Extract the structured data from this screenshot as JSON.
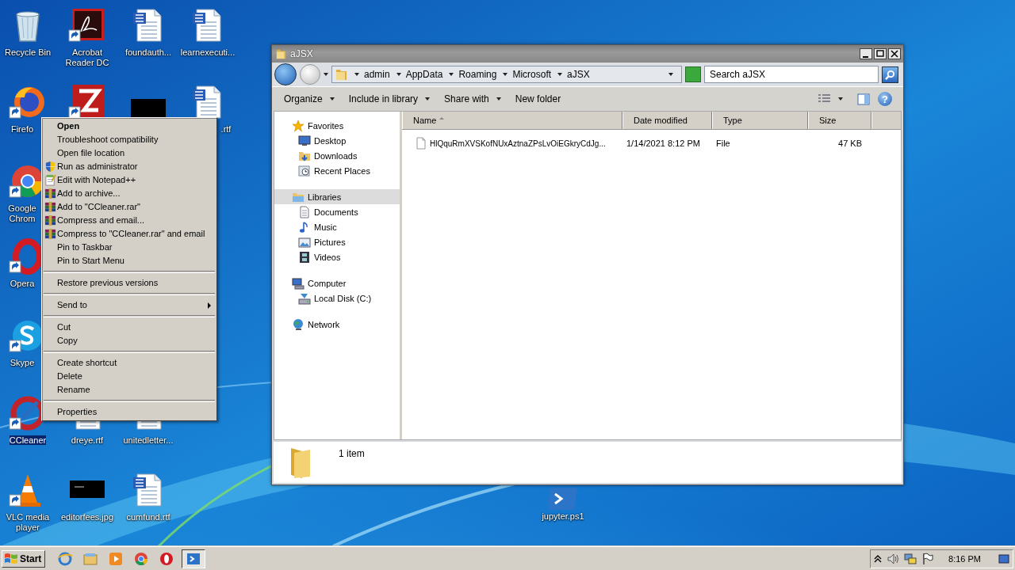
{
  "desktop_icons": [
    {
      "label": "Recycle Bin",
      "shortcut": false,
      "selected": false
    },
    {
      "label": "Acrobat Reader DC",
      "shortcut": true,
      "selected": false
    },
    {
      "label": "foundauth...",
      "shortcut": false,
      "selected": false
    },
    {
      "label": "learnexecuti...",
      "shortcut": false,
      "selected": false
    },
    {
      "label": "Firefo",
      "shortcut": true,
      "selected": false
    },
    {
      "shortcut": true,
      "selected": false
    },
    {
      "shortcut": false,
      "selected": false
    },
    {
      "label": ".rtf",
      "shortcut": false,
      "selected": false
    },
    {
      "label": "Google Chrom",
      "shortcut": true,
      "selected": false
    },
    {
      "label": "Opera",
      "shortcut": true,
      "selected": false
    },
    {
      "label": "Skype",
      "shortcut": true,
      "selected": false
    },
    {
      "label": "CCleaner",
      "shortcut": true,
      "selected": true
    },
    {
      "label": "dreye.rtf",
      "shortcut": false,
      "selected": false
    },
    {
      "label": "unitedletter...",
      "shortcut": false,
      "selected": false
    },
    {
      "label": "VLC media player",
      "shortcut": true,
      "selected": false
    },
    {
      "label": "editorfees.jpg",
      "shortcut": false,
      "selected": false
    },
    {
      "label": "cumfund.rtf",
      "shortcut": false,
      "selected": false
    },
    {
      "label": "jupyter.ps1",
      "shortcut": false,
      "selected": false
    }
  ],
  "context_menu": {
    "items": [
      {
        "kind": "item",
        "label": "Open",
        "default": true,
        "submenu": false
      },
      {
        "kind": "item",
        "label": "Troubleshoot compatibility",
        "default": false,
        "submenu": false
      },
      {
        "kind": "item",
        "label": "Open file location",
        "default": false,
        "submenu": false
      },
      {
        "kind": "item",
        "label": "Run as administrator",
        "default": false,
        "submenu": false
      },
      {
        "kind": "item",
        "label": "Edit with Notepad++",
        "default": false,
        "submenu": false
      },
      {
        "kind": "item",
        "label": "Add to archive...",
        "default": false,
        "submenu": false
      },
      {
        "kind": "item",
        "label": "Add to \"CCleaner.rar\"",
        "default": false,
        "submenu": false
      },
      {
        "kind": "item",
        "label": "Compress and email...",
        "default": false,
        "submenu": false
      },
      {
        "kind": "item",
        "label": "Compress to \"CCleaner.rar\" and email",
        "default": false,
        "submenu": false
      },
      {
        "kind": "item",
        "label": "Pin to Taskbar",
        "default": false,
        "submenu": false
      },
      {
        "kind": "item",
        "label": "Pin to Start Menu",
        "default": false,
        "submenu": false
      },
      {
        "kind": "separator"
      },
      {
        "kind": "item",
        "label": "Restore previous versions",
        "default": false,
        "submenu": false
      },
      {
        "kind": "separator"
      },
      {
        "kind": "item",
        "label": "Send to",
        "default": false,
        "submenu": true
      },
      {
        "kind": "separator"
      },
      {
        "kind": "item",
        "label": "Cut",
        "default": false,
        "submenu": false
      },
      {
        "kind": "item",
        "label": "Copy",
        "default": false,
        "submenu": false
      },
      {
        "kind": "separator"
      },
      {
        "kind": "item",
        "label": "Create shortcut",
        "default": false,
        "submenu": false
      },
      {
        "kind": "item",
        "label": "Delete",
        "default": false,
        "submenu": false
      },
      {
        "kind": "item",
        "label": "Rename",
        "default": false,
        "submenu": false
      },
      {
        "kind": "separator"
      },
      {
        "kind": "item",
        "label": "Properties",
        "default": false,
        "submenu": false
      }
    ]
  },
  "explorer": {
    "title": "aJSX",
    "breadcrumbs": [
      "admin",
      "AppData",
      "Roaming",
      "Microsoft",
      "aJSX"
    ],
    "search": {
      "placeholder": "Search aJSX"
    },
    "toolbar": [
      {
        "label": "Organize",
        "dropdown": true
      },
      {
        "label": "Include in library",
        "dropdown": true
      },
      {
        "label": "Share with",
        "dropdown": true
      },
      {
        "label": "New folder",
        "dropdown": false
      }
    ],
    "help": "?",
    "nav_pane": [
      {
        "label": "Favorites",
        "selected": false,
        "children": [
          {
            "label": "Desktop",
            "selected": false
          },
          {
            "label": "Downloads",
            "selected": false
          },
          {
            "label": "Recent Places",
            "selected": false
          }
        ]
      },
      {
        "label": "Libraries",
        "selected": true,
        "children": [
          {
            "label": "Documents",
            "selected": false
          },
          {
            "label": "Music",
            "selected": false
          },
          {
            "label": "Pictures",
            "selected": false
          },
          {
            "label": "Videos",
            "selected": false
          }
        ]
      },
      {
        "label": "Computer",
        "selected": false,
        "children": [
          {
            "label": "Local Disk (C:)",
            "selected": false
          }
        ]
      },
      {
        "label": "Network",
        "selected": false
      }
    ],
    "columns": [
      {
        "label": "Name",
        "sorted": true
      },
      {
        "label": "Date modified",
        "sorted": false
      },
      {
        "label": "Type",
        "sorted": false
      },
      {
        "label": "Size",
        "sorted": false
      }
    ],
    "rows": [
      {
        "cells": [
          "HlQquRmXVSKofNUxAztnaZPsLvOiEGkryCdJg...",
          "1/14/2021 8:12 PM",
          "File",
          "47 KB"
        ]
      }
    ],
    "status": "1 item"
  },
  "taskbar": {
    "start": "Start",
    "apps": [
      {
        "active": false
      },
      {
        "active": false
      },
      {
        "active": false
      },
      {
        "active": false
      },
      {
        "active": false
      },
      {
        "active": true
      }
    ],
    "clock": "8:16 PM"
  }
}
